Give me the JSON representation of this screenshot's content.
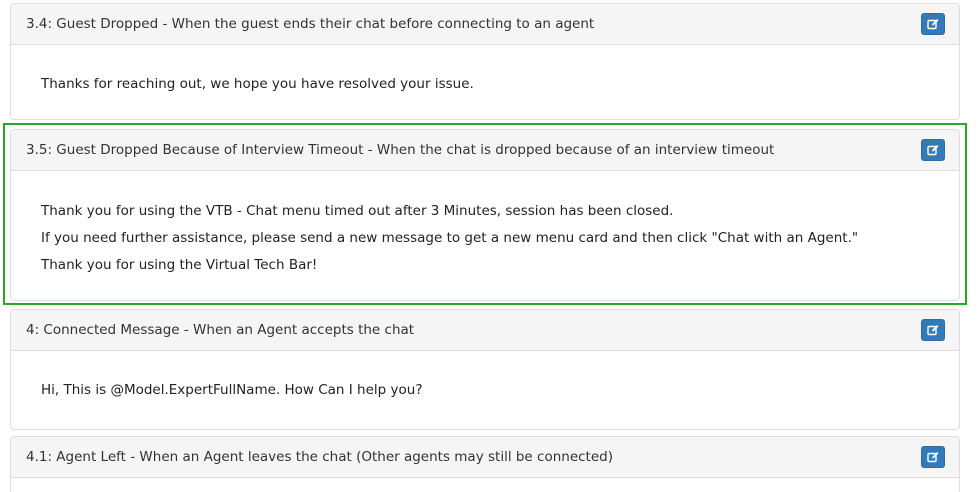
{
  "panels": [
    {
      "title": "3.4: Guest Dropped - When the guest ends their chat before connecting to an agent",
      "lines": [
        "Thanks for reaching out, we hope you have resolved your issue."
      ]
    },
    {
      "title": "3.5: Guest Dropped Because of Interview Timeout - When the chat is dropped because of an interview timeout",
      "lines": [
        "Thank you for using the VTB - Chat menu timed out after 3 Minutes, session has been closed.",
        "If you need further assistance, please send a new message to get a new menu card and then click \"Chat with an Agent.\"",
        "Thank you for using the Virtual Tech Bar!"
      ]
    },
    {
      "title": "4: Connected Message - When an Agent accepts the chat",
      "lines": [
        "Hi, This is @Model.ExpertFullName. How Can I help you?"
      ]
    },
    {
      "title": "4.1: Agent Left - When an Agent leaves the chat (Other agents may still be connected)",
      "lines": []
    }
  ],
  "colors": {
    "edit_button": "#337ab7",
    "highlight_border": "#2aa52a",
    "panel_heading_bg": "#f5f5f5"
  },
  "icons": {
    "edit": "edit-icon"
  }
}
